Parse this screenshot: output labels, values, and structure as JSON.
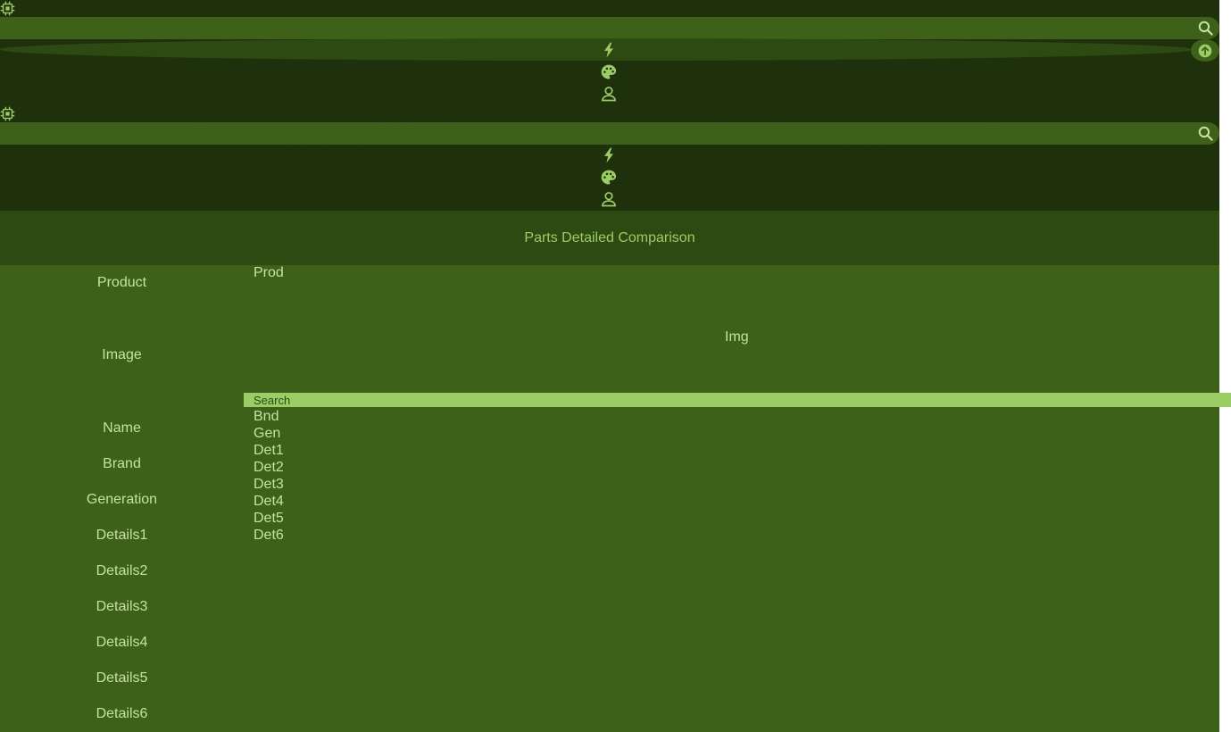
{
  "header": {
    "logo_icon": "chip-icon",
    "search_icon": "search-icon",
    "scroll_top_icon": "arrow-up-icon",
    "nav_icons": [
      "bolt-icon",
      "palette-icon",
      "user-icon"
    ]
  },
  "title": "Parts Detailed Comparison",
  "rows": {
    "product": "Product",
    "image": "Image",
    "name": "Name",
    "brand": "Brand",
    "generation": "Generation",
    "details1": "Details1",
    "details2": "Details2",
    "details3": "Details3",
    "details4": "Details4",
    "details5": "Details5",
    "details6": "Details6"
  },
  "values": {
    "product": "Prod",
    "image": "Img",
    "search_placeholder": "Search",
    "brand": "Bnd",
    "generation": "Gen",
    "details1": "Det1",
    "details2": "Det2",
    "details3": "Det3",
    "details4": "Det4",
    "details5": "Det5",
    "details6": "Det6"
  },
  "colors": {
    "header_bg": "#1f300d",
    "pill": "#3d6119",
    "title_bg": "#2d4a12",
    "table_bg": "#3d6119",
    "accent": "#9ccc65",
    "text": "#c5e1a5"
  }
}
